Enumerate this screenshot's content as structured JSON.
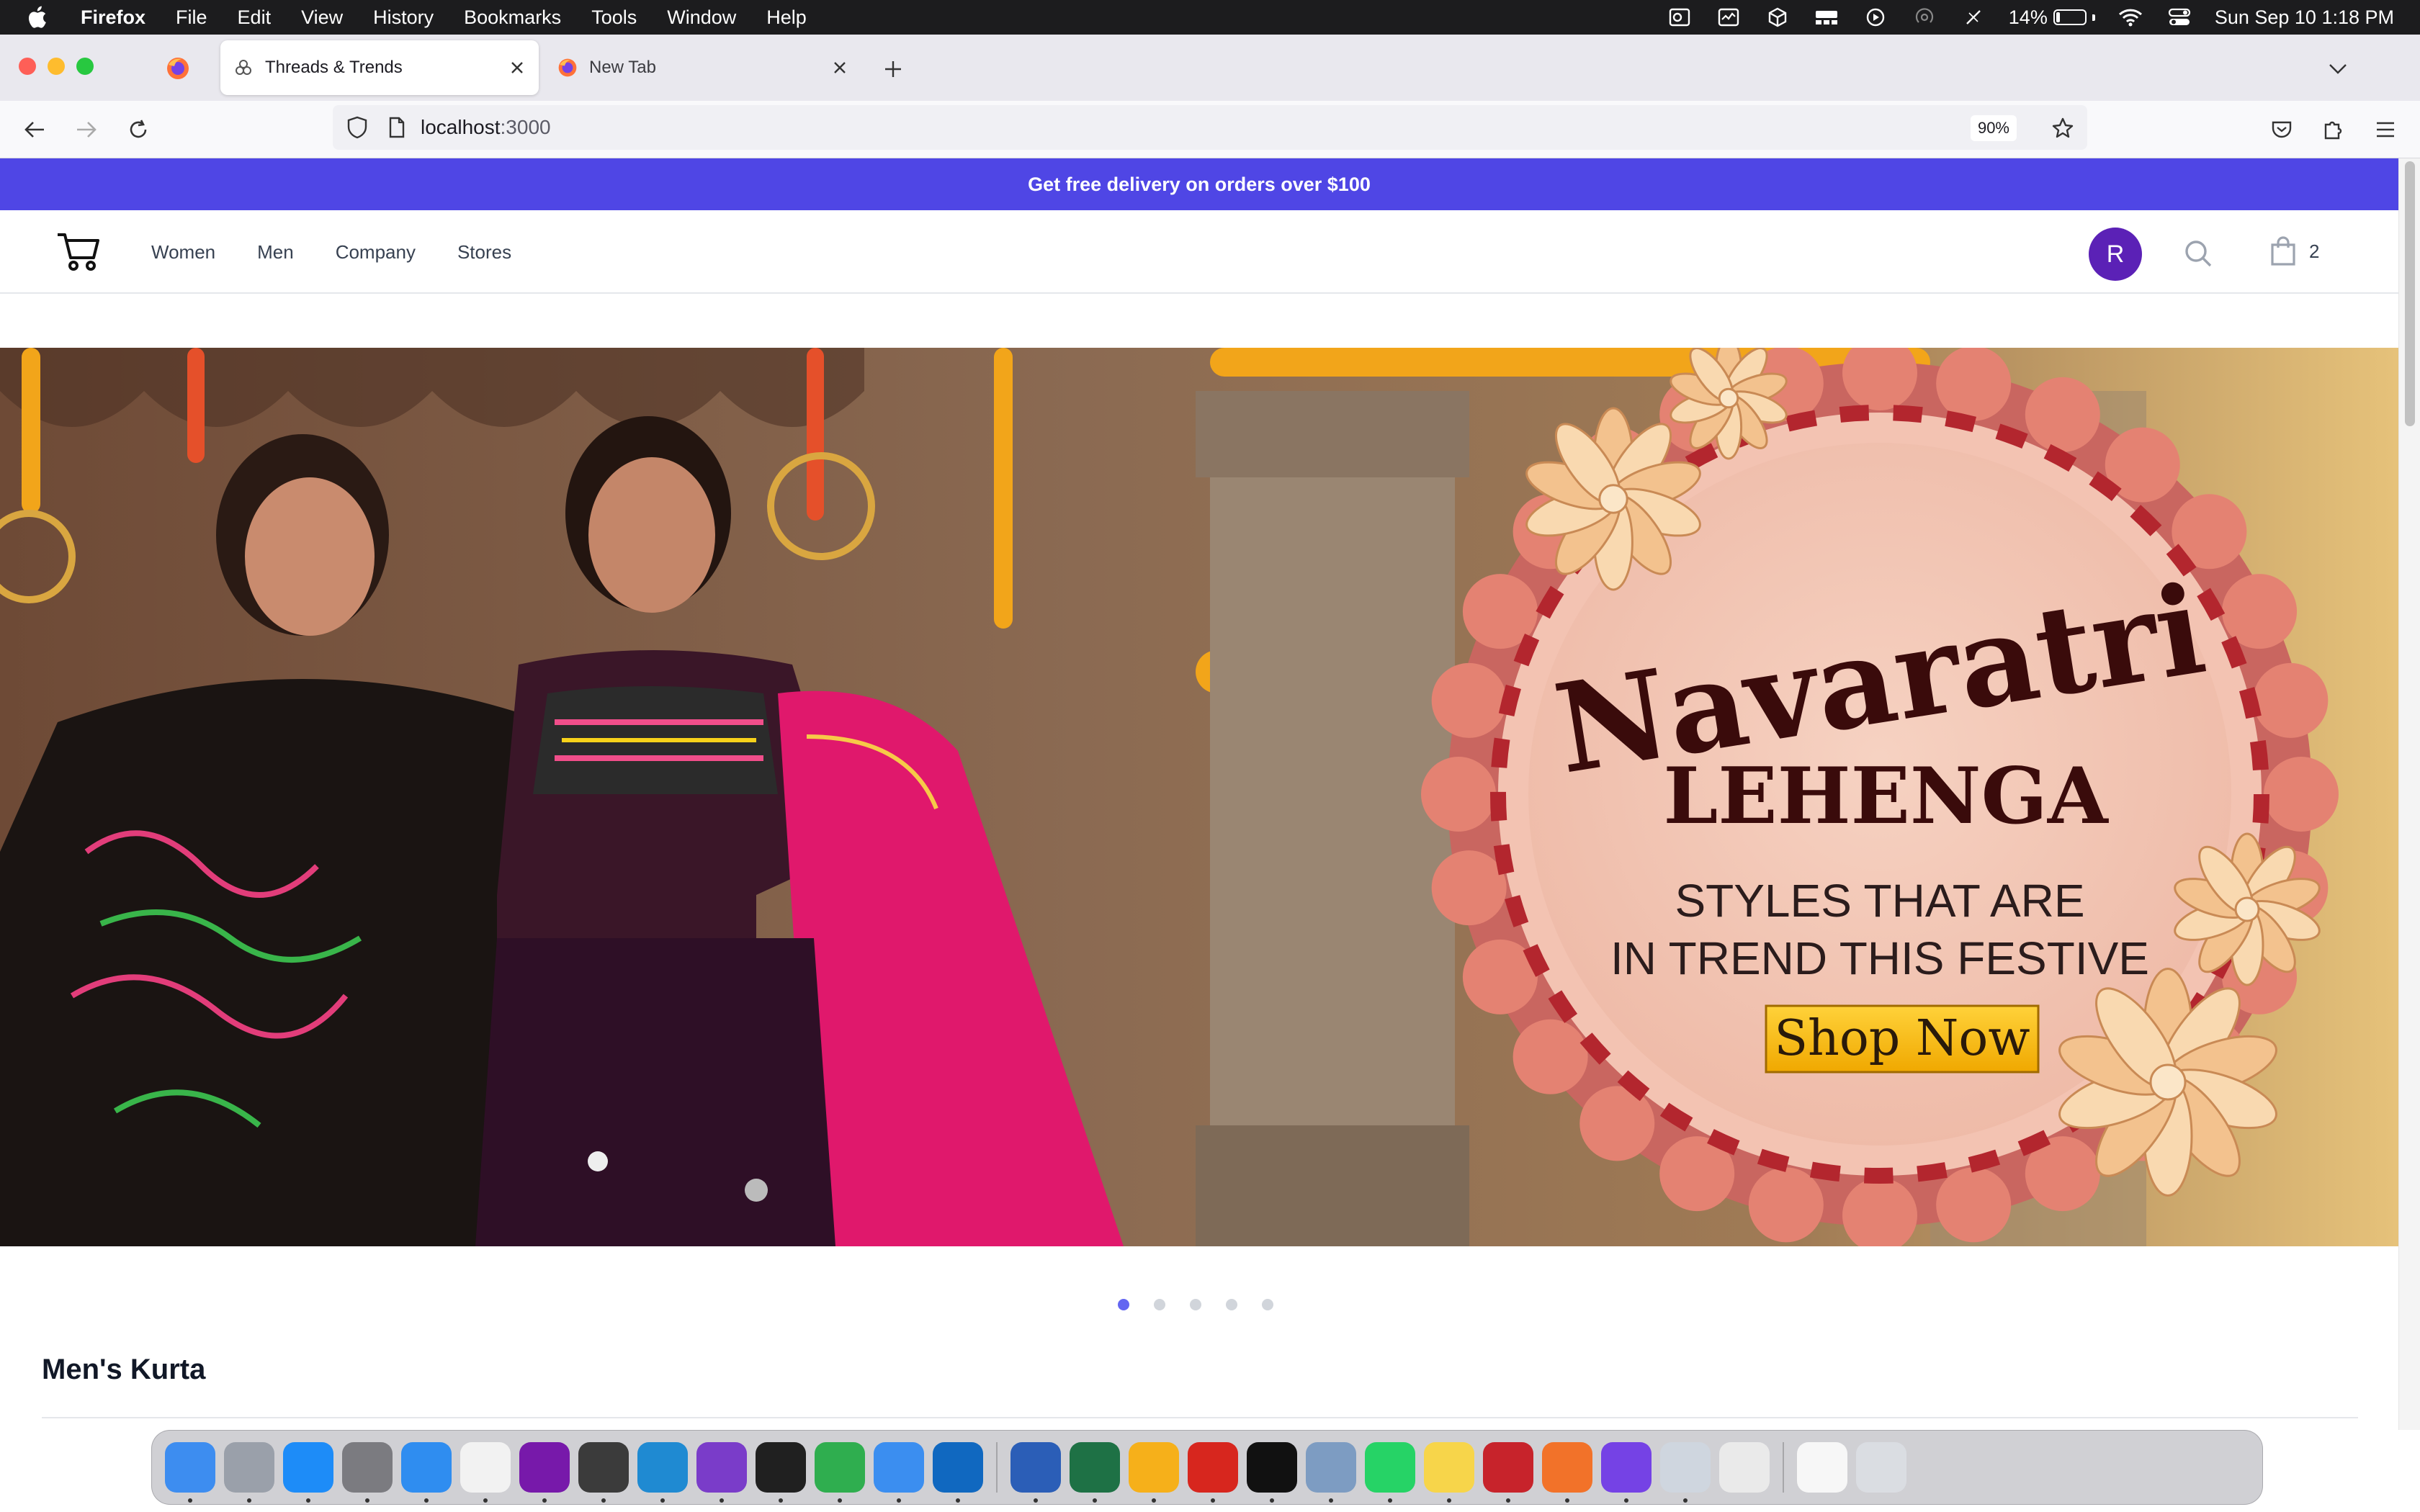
{
  "menubar": {
    "app_name": "Firefox",
    "items": [
      "File",
      "Edit",
      "View",
      "History",
      "Bookmarks",
      "Tools",
      "Window",
      "Help"
    ],
    "battery_percent": "14%",
    "battery_level": 0.14,
    "clock": "Sun Sep 10  1:18 PM"
  },
  "browser": {
    "tabs": [
      {
        "title": "Threads & Trends",
        "active": true
      },
      {
        "title": "New Tab",
        "active": false
      }
    ],
    "url_host": "localhost",
    "url_port": ":3000",
    "zoom": "90%"
  },
  "site": {
    "promo_text": "Get free delivery on orders over $100",
    "nav": [
      "Women",
      "Men",
      "Company",
      "Stores"
    ],
    "avatar_initial": "R",
    "cart_count": "2",
    "hero": {
      "title_script": "Navaratri",
      "title_main": "LEHENGA",
      "subtitle_line1": "STYLES THAT ARE",
      "subtitle_line2": "IN TREND THIS FESTIVE",
      "cta": "Shop Now"
    },
    "carousel": {
      "total": 5,
      "active_index": 0
    },
    "section_title": "Men's Kurta"
  },
  "colors": {
    "promo_bg": "#4f46e5",
    "avatar_bg": "#5b21b6",
    "dot_active": "#6366f1",
    "cta_bg": "#f6c000"
  },
  "dock": {
    "apps": [
      "finder-icon",
      "launchpad-icon",
      "app-store-icon",
      "system-settings-icon",
      "safari-icon",
      "chrome-icon",
      "onenote-icon",
      "sublime-text-icon",
      "vscode-icon",
      "github-desktop-icon",
      "terminal-icon",
      "numbers-icon",
      "icloud-icon",
      "outlook-icon",
      "word-icon",
      "excel-icon",
      "keynote-icon",
      "acrobat-icon",
      "intellij-icon",
      "preview-icon",
      "whatsapp-icon",
      "notes-icon",
      "scrobbles-icon",
      "pen-tool-icon",
      "firefox-icon",
      "quicktime-icon",
      "archive-icon",
      "document-thumbnail-icon",
      "trash-icon"
    ]
  }
}
